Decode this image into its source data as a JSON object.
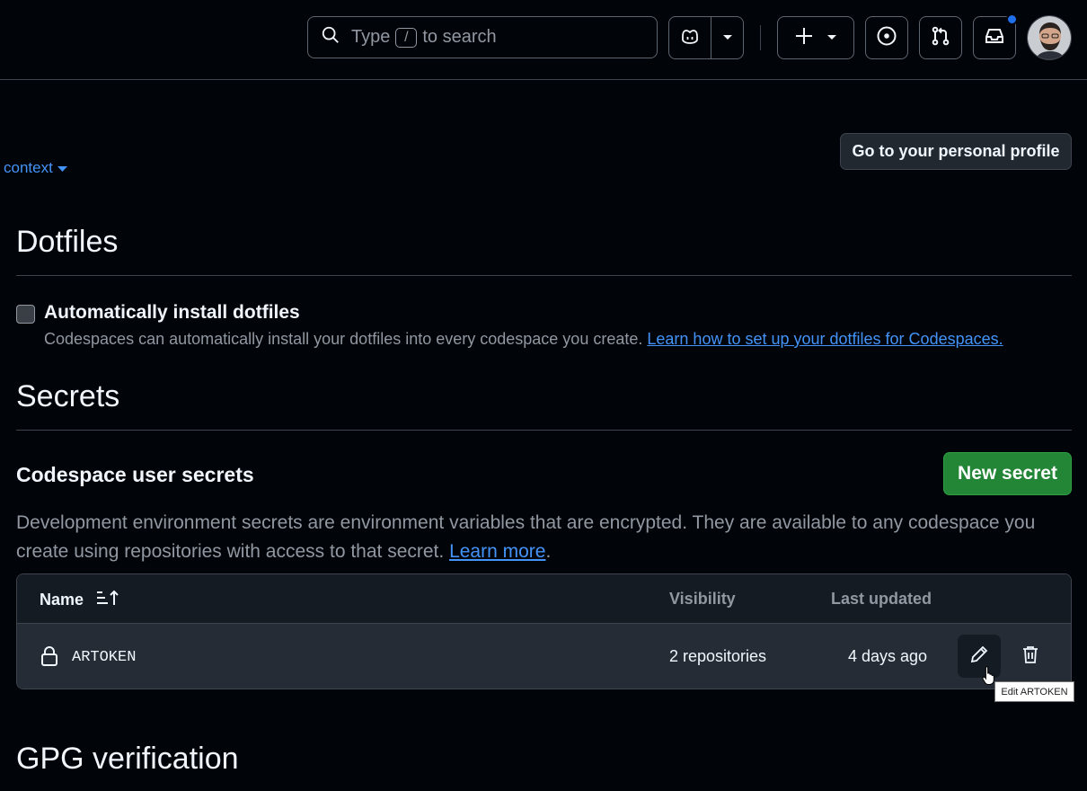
{
  "header": {
    "search": {
      "prefix": "Type",
      "key": "/",
      "suffix": "to search"
    },
    "icons": {
      "search": "search-icon",
      "copilot": "copilot-icon",
      "create": "plus-icon",
      "issues": "issue-opened-icon",
      "pulls": "git-pull-request-icon",
      "inbox": "inbox-icon"
    },
    "notification_color": "#1f6feb"
  },
  "context_link": "context",
  "profile_button": "Go to your personal profile",
  "dotfiles": {
    "title": "Dotfiles",
    "checkbox_label": "Automatically install dotfiles",
    "checked": false,
    "description": "Codespaces can automatically install your dotfiles into every codespace you create.",
    "link": "Learn how to set up your dotfiles for Codespaces."
  },
  "secrets": {
    "title": "Secrets",
    "subtitle": "Codespace user secrets",
    "new_button": "New secret",
    "description": "Development environment secrets are environment variables that are encrypted. They are available to any codespace you create using repositories with access to that secret.",
    "learn_more": "Learn more",
    "period": ".",
    "table": {
      "columns": {
        "name": "Name",
        "visibility": "Visibility",
        "updated": "Last updated"
      },
      "rows": [
        {
          "name": "ARTOKEN",
          "visibility": "2 repositories",
          "updated": "4 days ago"
        }
      ]
    },
    "tooltip": "Edit ARTOKEN"
  },
  "gpg": {
    "title": "GPG verification"
  },
  "colors": {
    "background": "#010409",
    "accent_link": "#4493f8",
    "primary_button": "#238636",
    "row_bg": "#262c36"
  }
}
